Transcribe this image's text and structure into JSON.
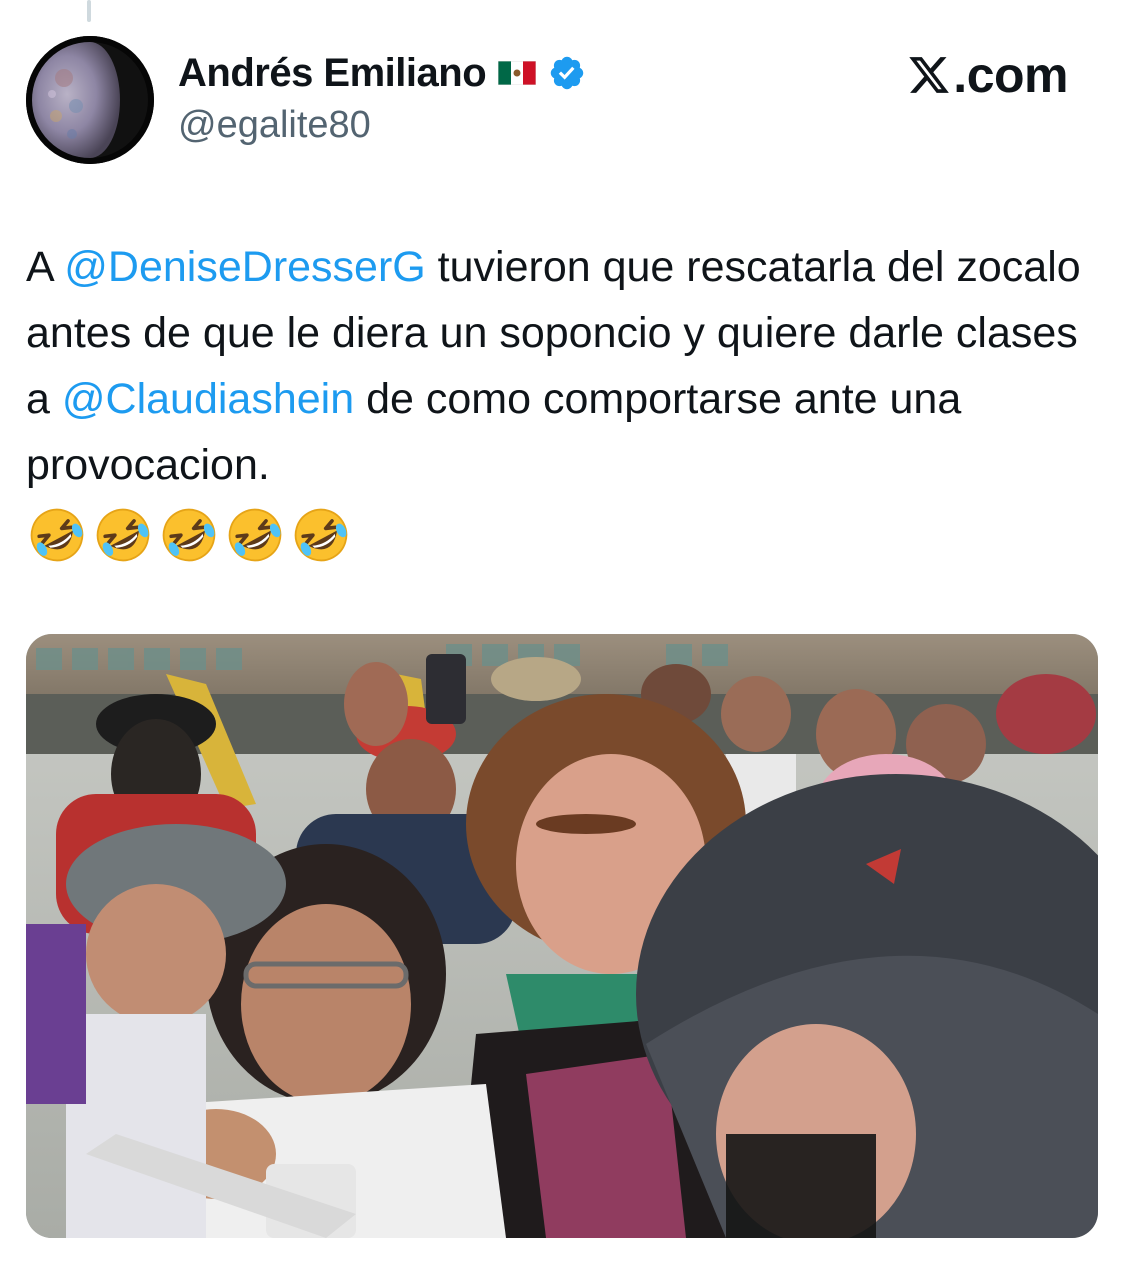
{
  "author": {
    "display_name": "Andrés Emiliano",
    "handle": "@egalite80",
    "flag_icon": "mexico-flag-icon",
    "verified_icon": "verified-badge-icon",
    "avatar_icon": "moon-avatar-icon"
  },
  "brand": {
    "label": ".com",
    "logo_icon": "x-logo-icon"
  },
  "tweet": {
    "segments": [
      {
        "text": "A ",
        "type": "text"
      },
      {
        "text": "@DeniseDresserG",
        "type": "mention"
      },
      {
        "text": " tuvieron que rescatarla del zocalo antes de que le diera un soponcio y quiere darle clases a ",
        "type": "text"
      },
      {
        "text": "@Claudiashein",
        "type": "mention"
      },
      {
        "text": " de como comportarse ante una provocacion.",
        "type": "text"
      }
    ],
    "emoji": [
      "🤣",
      "🤣",
      "🤣",
      "🤣",
      "🤣"
    ],
    "emoji_icon": "rolling-on-floor-laughing-emoji-icon"
  },
  "media": {
    "type": "photo",
    "icon": "crowd-photo"
  },
  "colors": {
    "text": "#0f1419",
    "secondary": "#536471",
    "link": "#1d9bf0",
    "verified": "#1d9bf0"
  }
}
